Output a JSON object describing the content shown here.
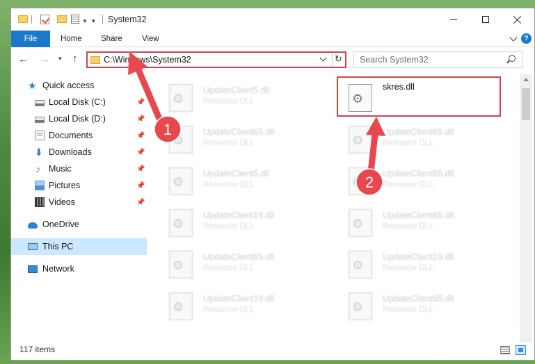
{
  "window": {
    "title": "System32"
  },
  "ribbon": {
    "tabs": [
      "File",
      "Home",
      "Share",
      "View"
    ]
  },
  "nav": {
    "address": "C:\\Windows\\System32",
    "search_placeholder": "Search System32"
  },
  "sidebar": {
    "items": [
      {
        "label": "Quick access",
        "icon": "star-icon",
        "pinned": false
      },
      {
        "label": "Local Disk (C:)",
        "icon": "drive-icon",
        "pinned": true
      },
      {
        "label": "Local Disk (D:)",
        "icon": "drive-icon",
        "pinned": true
      },
      {
        "label": "Documents",
        "icon": "documents-icon",
        "pinned": true
      },
      {
        "label": "Downloads",
        "icon": "downloads-icon",
        "pinned": true
      },
      {
        "label": "Music",
        "icon": "music-icon",
        "pinned": true
      },
      {
        "label": "Pictures",
        "icon": "pictures-icon",
        "pinned": true
      },
      {
        "label": "Videos",
        "icon": "videos-icon",
        "pinned": true
      },
      {
        "label": "OneDrive",
        "icon": "cloud-icon",
        "pinned": false
      },
      {
        "label": "This PC",
        "icon": "computer-icon",
        "pinned": false,
        "selected": true
      },
      {
        "label": "Network",
        "icon": "network-icon",
        "pinned": false
      }
    ]
  },
  "files": {
    "highlighted": {
      "name": "skres.dll"
    },
    "left_column": [
      {
        "name": "UpdateClient5.dll",
        "type": "Resource DLL"
      },
      {
        "name": "UpdateClient65.dll",
        "type": "Resource DLL"
      },
      {
        "name": "UpdateClient5.dll",
        "type": "Resource DLL"
      },
      {
        "name": "UpdateClient19.dll",
        "type": "Resource DLL"
      },
      {
        "name": "UpdateClient65.dll",
        "type": "Resource DLL"
      },
      {
        "name": "UpdateClient19.dll",
        "type": "Resource DLL"
      }
    ],
    "right_column": [
      {
        "name": "UpdateClient65.dll",
        "type": "Resource DLL"
      },
      {
        "name": "UpdateClient65.dll",
        "type": "Resource DLL"
      },
      {
        "name": "UpdateClient65.dll",
        "type": "Resource DLL"
      },
      {
        "name": "UpdateClient19.dll",
        "type": "Resource DLL"
      },
      {
        "name": "UpdateClient65.dll",
        "type": "Resource DLL"
      }
    ]
  },
  "status": {
    "item_count": "117 items"
  },
  "annotations": [
    {
      "label": "1"
    },
    {
      "label": "2"
    }
  ],
  "colors": {
    "accent": "#1979ca",
    "highlight_red": "#d9404a",
    "selection": "#cce8ff"
  }
}
